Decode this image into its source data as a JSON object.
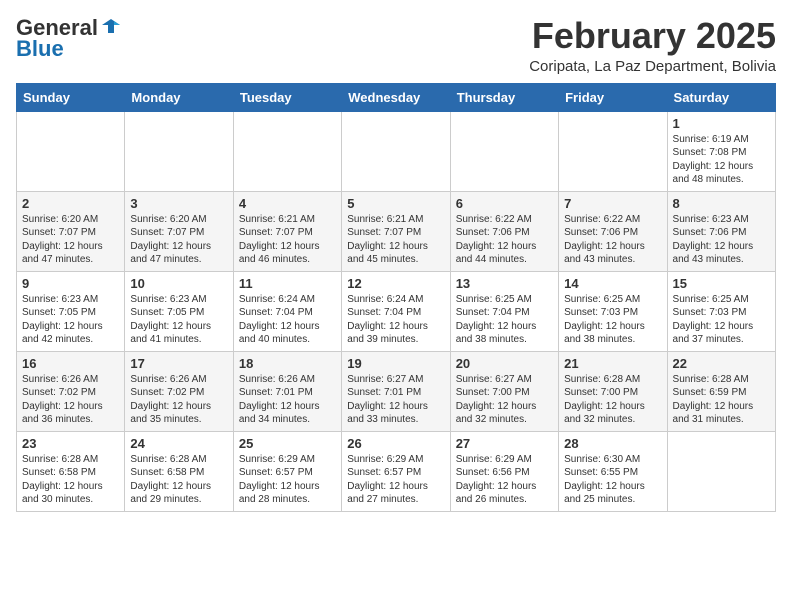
{
  "header": {
    "logo_general": "General",
    "logo_blue": "Blue",
    "month_year": "February 2025",
    "location": "Coripata, La Paz Department, Bolivia"
  },
  "weekdays": [
    "Sunday",
    "Monday",
    "Tuesday",
    "Wednesday",
    "Thursday",
    "Friday",
    "Saturday"
  ],
  "weeks": [
    [
      {
        "day": "",
        "info": ""
      },
      {
        "day": "",
        "info": ""
      },
      {
        "day": "",
        "info": ""
      },
      {
        "day": "",
        "info": ""
      },
      {
        "day": "",
        "info": ""
      },
      {
        "day": "",
        "info": ""
      },
      {
        "day": "1",
        "info": "Sunrise: 6:19 AM\nSunset: 7:08 PM\nDaylight: 12 hours\nand 48 minutes."
      }
    ],
    [
      {
        "day": "2",
        "info": "Sunrise: 6:20 AM\nSunset: 7:07 PM\nDaylight: 12 hours\nand 47 minutes."
      },
      {
        "day": "3",
        "info": "Sunrise: 6:20 AM\nSunset: 7:07 PM\nDaylight: 12 hours\nand 47 minutes."
      },
      {
        "day": "4",
        "info": "Sunrise: 6:21 AM\nSunset: 7:07 PM\nDaylight: 12 hours\nand 46 minutes."
      },
      {
        "day": "5",
        "info": "Sunrise: 6:21 AM\nSunset: 7:07 PM\nDaylight: 12 hours\nand 45 minutes."
      },
      {
        "day": "6",
        "info": "Sunrise: 6:22 AM\nSunset: 7:06 PM\nDaylight: 12 hours\nand 44 minutes."
      },
      {
        "day": "7",
        "info": "Sunrise: 6:22 AM\nSunset: 7:06 PM\nDaylight: 12 hours\nand 43 minutes."
      },
      {
        "day": "8",
        "info": "Sunrise: 6:23 AM\nSunset: 7:06 PM\nDaylight: 12 hours\nand 43 minutes."
      }
    ],
    [
      {
        "day": "9",
        "info": "Sunrise: 6:23 AM\nSunset: 7:05 PM\nDaylight: 12 hours\nand 42 minutes."
      },
      {
        "day": "10",
        "info": "Sunrise: 6:23 AM\nSunset: 7:05 PM\nDaylight: 12 hours\nand 41 minutes."
      },
      {
        "day": "11",
        "info": "Sunrise: 6:24 AM\nSunset: 7:04 PM\nDaylight: 12 hours\nand 40 minutes."
      },
      {
        "day": "12",
        "info": "Sunrise: 6:24 AM\nSunset: 7:04 PM\nDaylight: 12 hours\nand 39 minutes."
      },
      {
        "day": "13",
        "info": "Sunrise: 6:25 AM\nSunset: 7:04 PM\nDaylight: 12 hours\nand 38 minutes."
      },
      {
        "day": "14",
        "info": "Sunrise: 6:25 AM\nSunset: 7:03 PM\nDaylight: 12 hours\nand 38 minutes."
      },
      {
        "day": "15",
        "info": "Sunrise: 6:25 AM\nSunset: 7:03 PM\nDaylight: 12 hours\nand 37 minutes."
      }
    ],
    [
      {
        "day": "16",
        "info": "Sunrise: 6:26 AM\nSunset: 7:02 PM\nDaylight: 12 hours\nand 36 minutes."
      },
      {
        "day": "17",
        "info": "Sunrise: 6:26 AM\nSunset: 7:02 PM\nDaylight: 12 hours\nand 35 minutes."
      },
      {
        "day": "18",
        "info": "Sunrise: 6:26 AM\nSunset: 7:01 PM\nDaylight: 12 hours\nand 34 minutes."
      },
      {
        "day": "19",
        "info": "Sunrise: 6:27 AM\nSunset: 7:01 PM\nDaylight: 12 hours\nand 33 minutes."
      },
      {
        "day": "20",
        "info": "Sunrise: 6:27 AM\nSunset: 7:00 PM\nDaylight: 12 hours\nand 32 minutes."
      },
      {
        "day": "21",
        "info": "Sunrise: 6:28 AM\nSunset: 7:00 PM\nDaylight: 12 hours\nand 32 minutes."
      },
      {
        "day": "22",
        "info": "Sunrise: 6:28 AM\nSunset: 6:59 PM\nDaylight: 12 hours\nand 31 minutes."
      }
    ],
    [
      {
        "day": "23",
        "info": "Sunrise: 6:28 AM\nSunset: 6:58 PM\nDaylight: 12 hours\nand 30 minutes."
      },
      {
        "day": "24",
        "info": "Sunrise: 6:28 AM\nSunset: 6:58 PM\nDaylight: 12 hours\nand 29 minutes."
      },
      {
        "day": "25",
        "info": "Sunrise: 6:29 AM\nSunset: 6:57 PM\nDaylight: 12 hours\nand 28 minutes."
      },
      {
        "day": "26",
        "info": "Sunrise: 6:29 AM\nSunset: 6:57 PM\nDaylight: 12 hours\nand 27 minutes."
      },
      {
        "day": "27",
        "info": "Sunrise: 6:29 AM\nSunset: 6:56 PM\nDaylight: 12 hours\nand 26 minutes."
      },
      {
        "day": "28",
        "info": "Sunrise: 6:30 AM\nSunset: 6:55 PM\nDaylight: 12 hours\nand 25 minutes."
      },
      {
        "day": "",
        "info": ""
      }
    ]
  ]
}
